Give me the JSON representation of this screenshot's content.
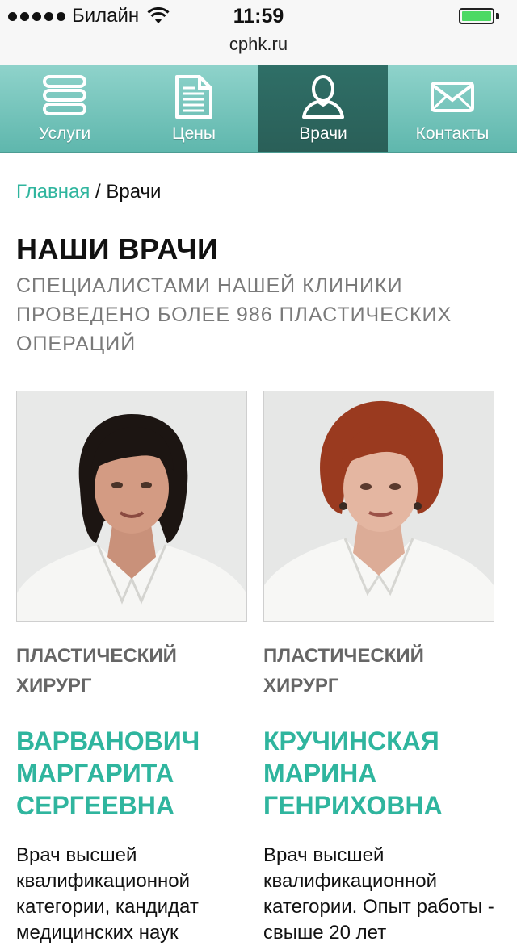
{
  "status_bar": {
    "carrier": "Билайн",
    "time": "11:59",
    "signal_bars": 5
  },
  "browser": {
    "url": "cphk.ru"
  },
  "nav": {
    "items": [
      {
        "label": "Услуги",
        "icon": "list-icon",
        "active": false
      },
      {
        "label": "Цены",
        "icon": "document-icon",
        "active": false
      },
      {
        "label": "Врачи",
        "icon": "user-icon",
        "active": true
      },
      {
        "label": "Контакты",
        "icon": "envelope-icon",
        "active": false
      }
    ]
  },
  "breadcrumb": {
    "home": "Главная",
    "separator": " / ",
    "current": "Врачи"
  },
  "page": {
    "title": "НАШИ ВРАЧИ",
    "subtitle": "СПЕЦИАЛИСТАМИ НАШЕЙ КЛИНИКИ ПРОВЕДЕНО БОЛЕЕ 986 ПЛАСТИЧЕСКИХ ОПЕРАЦИЙ"
  },
  "doctors": [
    {
      "role": "ПЛАСТИЧЕСКИЙ ХИРУРГ",
      "name": "ВАРВАНОВИЧ МАРГАРИТА СЕРГЕЕВНА",
      "description": "Врач высшей квалификационной категории, кандидат медицинских наук"
    },
    {
      "role": "ПЛАСТИЧЕСКИЙ ХИРУРГ",
      "name": "КРУЧИНСКАЯ МАРИНА ГЕНРИХОВНА",
      "description": "Врач высшей квалификационной категории. Опыт работы - свыше 20 лет"
    }
  ],
  "colors": {
    "accent": "#2fb59e",
    "nav_bg": "#6cc2b8",
    "nav_active": "#2d6a62",
    "subtitle": "#7a7a7a",
    "battery": "#4cd964"
  }
}
